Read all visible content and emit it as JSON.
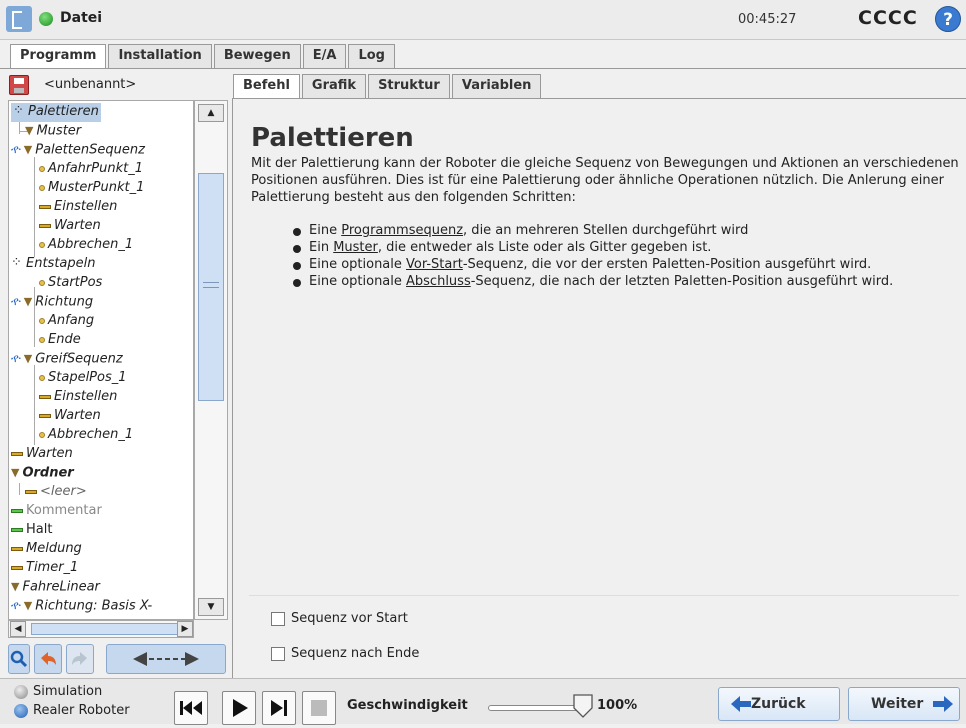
{
  "topbar": {
    "file_label": "Datei",
    "clock": "00:45:27",
    "robot_name": "CCCC",
    "help_glyph": "?"
  },
  "main_tabs": [
    "Programm",
    "Installation",
    "Bewegen",
    "E/A",
    "Log"
  ],
  "program_name": "<unbenannt>",
  "sub_tabs": [
    "Befehl",
    "Grafik",
    "Struktur",
    "Variablen"
  ],
  "tree": {
    "nodes": [
      "Palettieren",
      "Muster",
      "PalettenSequenz",
      "AnfahrPunkt_1",
      "MusterPunkt_1",
      "Einstellen",
      "Warten",
      "Abbrechen_1",
      "Entstapeln",
      "StartPos",
      "Richtung",
      "Anfang",
      "Ende",
      "GreifSequenz",
      "StapelPos_1",
      "Einstellen",
      "Warten",
      "Abbrechen_1",
      "Warten",
      "Ordner",
      "<leer>",
      "Kommentar",
      "Halt",
      "Meldung",
      "Timer_1",
      "FahreLinear",
      "Richtung: Basis X-"
    ]
  },
  "content": {
    "title": "Palettieren",
    "intro": "Mit der Palettierung kann der Roboter die gleiche Sequenz von Bewegungen und Aktionen an verschiedenen Positionen ausführen. Dies ist für eine Palettierung oder ähnliche Operationen nützlich. Die Anlerung einer Palettierung besteht aus den folgenden Schritten:",
    "bullets": [
      {
        "pre": "Eine ",
        "link": "Programmsequenz",
        "post": ", die an mehreren Stellen durchgeführt wird"
      },
      {
        "pre": "Ein ",
        "link": "Muster",
        "post": ", die entweder als Liste oder als Gitter gegeben ist."
      },
      {
        "pre": "Eine optionale ",
        "link": "Vor-Start",
        "post": "-Sequenz, die vor der ersten Paletten-Position ausgeführt wird."
      },
      {
        "pre": "Eine optionale ",
        "link": "Abschluss",
        "post": "-Sequenz, die nach der letzten Paletten-Position ausgeführt wird."
      }
    ],
    "options": {
      "pre_start": "Sequenz vor Start",
      "post_end": "Sequenz nach Ende"
    }
  },
  "bottombar": {
    "simulation": "Simulation",
    "real_robot": "Realer Roboter",
    "speed_label": "Geschwindigkeit",
    "speed_value": "100%",
    "speed_fraction": 1.0,
    "back": "Zurück",
    "next": "Weiter"
  },
  "colors": {
    "accent": "#3a7ad0",
    "selection": "#b9cfe8",
    "status_green": "#1c8d1c"
  }
}
